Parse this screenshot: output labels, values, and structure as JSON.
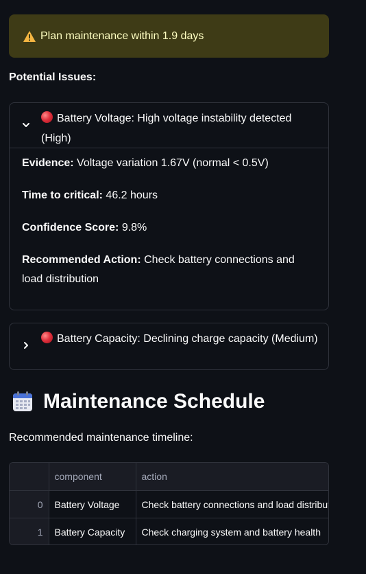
{
  "alert": {
    "icon": "warning-icon",
    "text": "Plan maintenance within 1.9 days",
    "color": "#3e3b16"
  },
  "issues_label": "Potential Issues:",
  "issues": [
    {
      "icon": "red-circle-icon",
      "title": "Battery Voltage: High voltage instability detected (High)",
      "expanded": true,
      "fields": [
        {
          "label": "Evidence:",
          "value": "Voltage variation 1.67V (normal < 0.5V)"
        },
        {
          "label": "Time to critical:",
          "value": "46.2 hours"
        },
        {
          "label": "Confidence Score:",
          "value": "9.8%"
        },
        {
          "label": "Recommended Action:",
          "value": "Check battery connections and load distribution"
        }
      ]
    },
    {
      "icon": "red-circle-icon",
      "title": "Battery Capacity: Declining charge capacity (Medium)",
      "expanded": false
    }
  ],
  "schedule": {
    "icon": "calendar-icon",
    "title": "Maintenance Schedule",
    "subtitle": "Recommended maintenance timeline:",
    "columns": [
      "",
      "component",
      "action"
    ],
    "rows": [
      {
        "index": "0",
        "component": "Battery Voltage",
        "action": "Check battery connections and load distribution"
      },
      {
        "index": "1",
        "component": "Battery Capacity",
        "action": "Check charging system and battery health"
      }
    ]
  }
}
